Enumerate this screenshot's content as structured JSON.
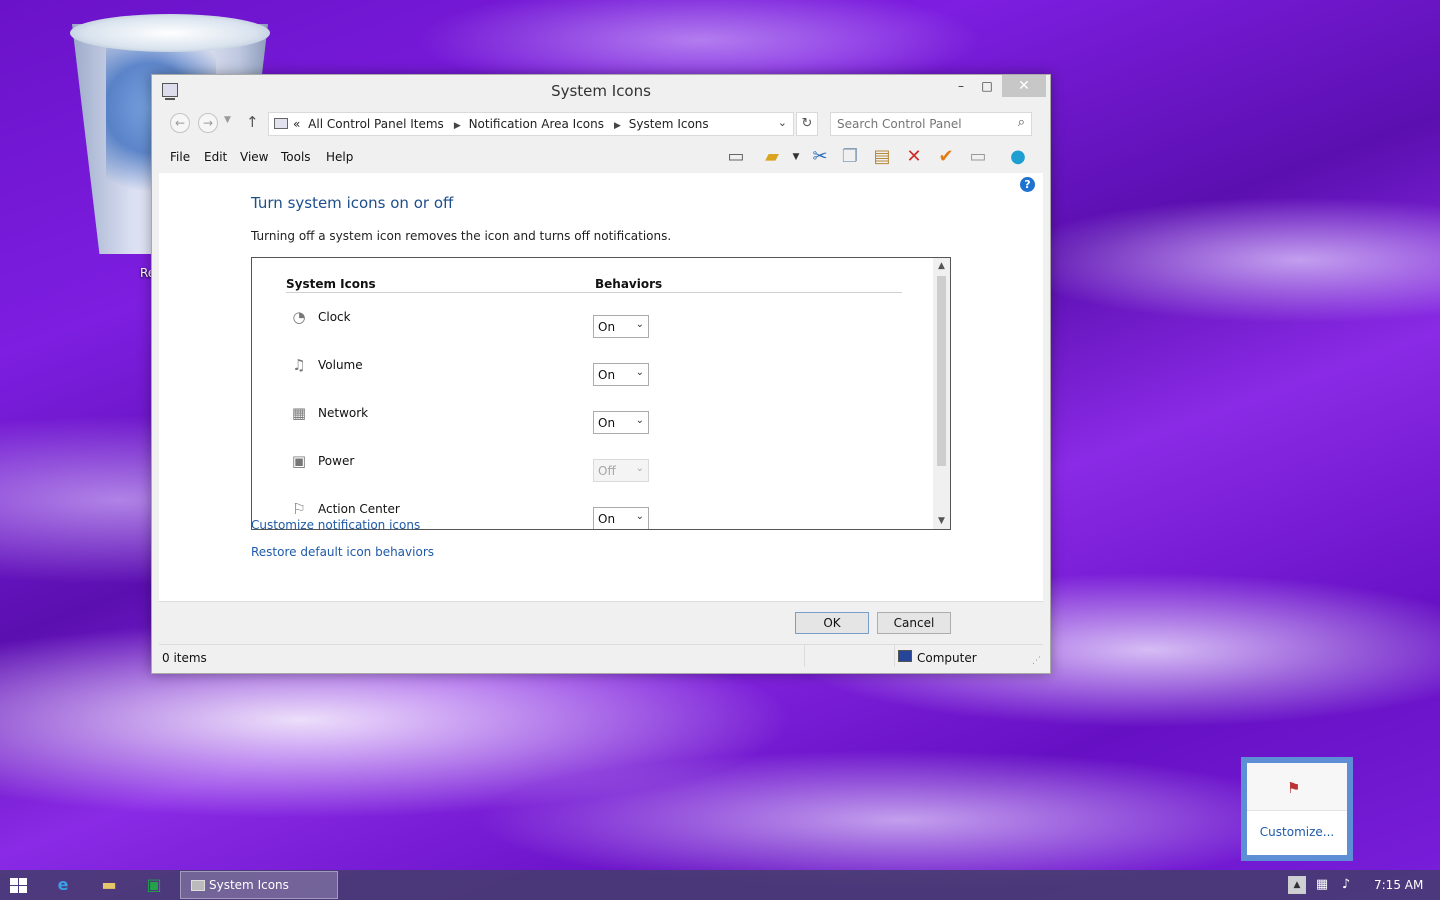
{
  "desktop": {
    "recycle_bin_label": "Re"
  },
  "window": {
    "title": "System Icons",
    "controls": {
      "minimize": "–",
      "maximize": "□",
      "close": "✕"
    },
    "address": {
      "prefix": "«",
      "crumbs": [
        "All Control Panel Items",
        "Notification Area Icons",
        "System Icons"
      ]
    },
    "search": {
      "placeholder": "Search Control Panel",
      "value": ""
    },
    "menu": [
      "File",
      "Edit",
      "View",
      "Tools",
      "Help"
    ],
    "content": {
      "heading": "Turn system icons on or off",
      "description": "Turning off a system icon removes the icon and turns off notifications.",
      "columns": {
        "icons": "System Icons",
        "behaviors": "Behaviors"
      },
      "rows": [
        {
          "name": "Clock",
          "value": "On",
          "enabled": true,
          "icon": "clock-icon"
        },
        {
          "name": "Volume",
          "value": "On",
          "enabled": true,
          "icon": "volume-icon"
        },
        {
          "name": "Network",
          "value": "On",
          "enabled": true,
          "icon": "network-icon"
        },
        {
          "name": "Power",
          "value": "Off",
          "enabled": false,
          "icon": "power-icon"
        },
        {
          "name": "Action Center",
          "value": "On",
          "enabled": true,
          "icon": "flag-icon"
        }
      ],
      "links": {
        "customize": "Customize notification icons",
        "restore": "Restore default icon behaviors"
      }
    },
    "buttons": {
      "ok": "OK",
      "cancel": "Cancel"
    },
    "status": {
      "count": "0 items",
      "zone": "Computer"
    }
  },
  "taskbar": {
    "task_label": "System Icons",
    "time": "7:15 AM"
  },
  "flyout": {
    "link": "Customize..."
  },
  "colors": {
    "heading": "#1e4e8c",
    "link": "#1e5aa8",
    "accent": "#5e8fd6"
  }
}
